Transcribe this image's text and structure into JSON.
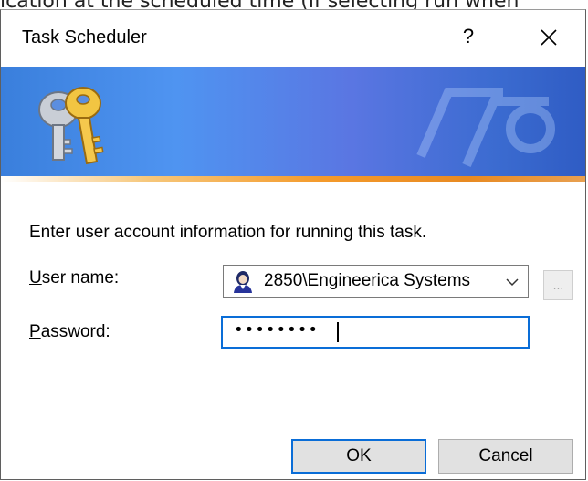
{
  "background": {
    "text": "ication at the scheduled time (if selecting run when"
  },
  "dialog": {
    "title": "Task Scheduler",
    "help_label": "?",
    "close_icon": "close-icon"
  },
  "banner": {
    "icon": "keys-icon",
    "accent": "#f49a2b",
    "base": "#4f94f1"
  },
  "form": {
    "prompt": "Enter user account information for running this task.",
    "username_label_accel": "U",
    "username_label_rest": "ser name:",
    "username_value": "2850\\Engineerica Systems",
    "password_label_accel": "P",
    "password_label_rest": "assword:",
    "password_value": "••••••••",
    "browse_label": "..."
  },
  "buttons": {
    "ok": "OK",
    "cancel": "Cancel"
  },
  "colors": {
    "focus": "#0a6dd7",
    "button_bg": "#e1e1e1"
  }
}
